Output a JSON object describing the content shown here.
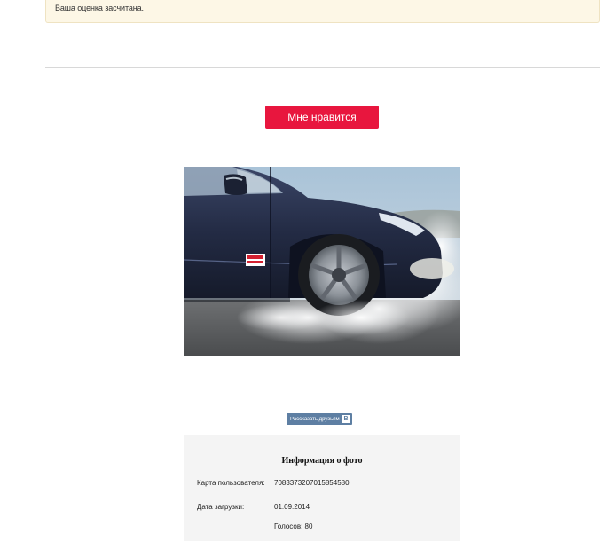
{
  "notice": {
    "text": "Ваша оценка засчитана."
  },
  "like_button": {
    "label": "Мне нравится"
  },
  "vk_share": {
    "label": "Рассказать друзьям",
    "logo": "В"
  },
  "photo_info": {
    "title": "Информация о фото",
    "user_card_label": "Карта пользователя:",
    "user_card_value": "7083373207015854580",
    "upload_date_label": "Дата загрузки:",
    "upload_date_value": "01.09.2014",
    "votes_text": "Голосов: 80"
  },
  "photo": {
    "icon": "car-photo"
  }
}
